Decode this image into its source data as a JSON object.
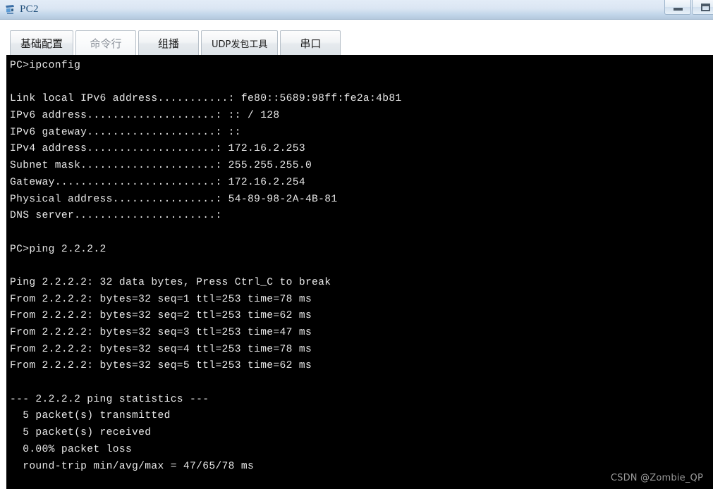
{
  "window": {
    "title": "PC2",
    "icon": "pc-device-icon",
    "controls": [
      {
        "name": "minimize-button",
        "glyph": "minimize-icon"
      },
      {
        "name": "maximize-button",
        "glyph": "maximize-icon"
      }
    ]
  },
  "tabs": [
    {
      "label": "基础配置",
      "active": false,
      "small": false
    },
    {
      "label": "命令行",
      "active": true,
      "small": false
    },
    {
      "label": "组播",
      "active": false,
      "small": false
    },
    {
      "label": "UDP发包工具",
      "active": false,
      "small": true
    },
    {
      "label": "串口",
      "active": false,
      "small": false
    }
  ],
  "terminal": {
    "prompt_1": "PC>ipconfig",
    "prompt_2": "PC>ping 2.2.2.2",
    "ipconfig": {
      "link_local_ipv6_address": "fe80::5689:98ff:fe2a:4b81",
      "ipv6_address": ":: / 128",
      "ipv6_gateway": "::",
      "ipv4_address": "172.16.2.253",
      "subnet_mask": "255.255.255.0",
      "gateway": "172.16.2.254",
      "physical_address": "54-89-98-2A-4B-81",
      "dns_server": ""
    },
    "lines": [
      "PC>ipconfig",
      "",
      "Link local IPv6 address...........: fe80::5689:98ff:fe2a:4b81",
      "IPv6 address....................: :: / 128",
      "IPv6 gateway....................: ::",
      "IPv4 address....................: 172.16.2.253",
      "Subnet mask.....................: 255.255.255.0",
      "Gateway.........................: 172.16.2.254",
      "Physical address................: 54-89-98-2A-4B-81",
      "DNS server......................:",
      "",
      "PC>ping 2.2.2.2",
      "",
      "Ping 2.2.2.2: 32 data bytes, Press Ctrl_C to break",
      "From 2.2.2.2: bytes=32 seq=1 ttl=253 time=78 ms",
      "From 2.2.2.2: bytes=32 seq=2 ttl=253 time=62 ms",
      "From 2.2.2.2: bytes=32 seq=3 ttl=253 time=47 ms",
      "From 2.2.2.2: bytes=32 seq=4 ttl=253 time=78 ms",
      "From 2.2.2.2: bytes=32 seq=5 ttl=253 time=62 ms",
      "",
      "--- 2.2.2.2 ping statistics ---",
      "  5 packet(s) transmitted",
      "  5 packet(s) received",
      "  0.00% packet loss",
      "  round-trip min/avg/max = 47/65/78 ms"
    ],
    "ping": {
      "target": "2.2.2.2",
      "header": "Ping 2.2.2.2: 32 data bytes, Press Ctrl_C to break",
      "replies": [
        {
          "from": "2.2.2.2",
          "bytes": 32,
          "seq": 1,
          "ttl": 253,
          "time_ms": 78
        },
        {
          "from": "2.2.2.2",
          "bytes": 32,
          "seq": 2,
          "ttl": 253,
          "time_ms": 62
        },
        {
          "from": "2.2.2.2",
          "bytes": 32,
          "seq": 3,
          "ttl": 253,
          "time_ms": 47
        },
        {
          "from": "2.2.2.2",
          "bytes": 32,
          "seq": 4,
          "ttl": 253,
          "time_ms": 78
        },
        {
          "from": "2.2.2.2",
          "bytes": 32,
          "seq": 5,
          "ttl": 253,
          "time_ms": 62
        }
      ],
      "statistics_title": "--- 2.2.2.2 ping statistics ---",
      "transmitted": "5 packet(s) transmitted",
      "received": "5 packet(s) received",
      "packet_loss": "0.00% packet loss",
      "round_trip": "round-trip min/avg/max = 47/65/78 ms"
    }
  },
  "watermark": "CSDN @Zombie_QP",
  "colors": {
    "title_text": "#1f4e79",
    "terminal_bg": "#000000",
    "terminal_text": "#e9e9e9",
    "watermark_text": "#9a9a9a"
  }
}
